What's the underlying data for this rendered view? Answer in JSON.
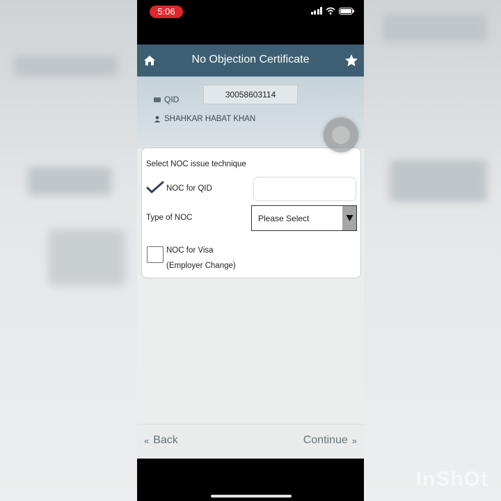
{
  "status_bar": {
    "time": "5:06"
  },
  "header": {
    "title": "No Objection Certificate",
    "home_icon": "home-icon",
    "star_icon": "star-icon"
  },
  "profile": {
    "qid_label": "QID",
    "qid_value": "30058603114",
    "name": "SHAHKAR HABAT KHAN"
  },
  "form": {
    "section_label": "Select NOC issue technique",
    "noc_qid": {
      "label": "NOC for QID",
      "checked": true,
      "value": ""
    },
    "type_of_noc": {
      "label": "Type of NOC",
      "selected": "Please Select"
    },
    "noc_visa": {
      "label_line1": "NOC for Visa",
      "label_line2": "(Employer Change)",
      "checked": false
    }
  },
  "footer": {
    "back_label": "Back",
    "continue_label": "Continue"
  },
  "watermark": "InShOt",
  "colors": {
    "header_bg": "#3e5f73",
    "time_pill": "#e0262a",
    "footer_text": "#627480"
  }
}
